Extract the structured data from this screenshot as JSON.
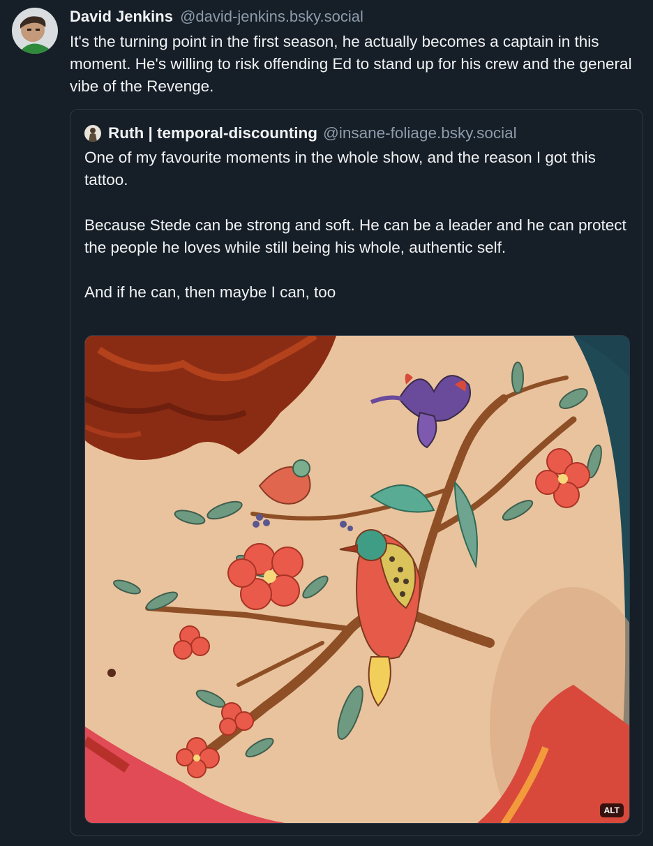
{
  "post": {
    "author_name": "David Jenkins",
    "author_handle": "@david-jenkins.bsky.social",
    "text": "It's the turning point in the first season, he actually becomes a captain in this moment. He's willing to risk offending Ed to stand up for his crew and the general vibe of the Revenge.",
    "avatar_icon": "avatar-photo-icon"
  },
  "quote": {
    "author_name": "Ruth | temporal-discounting",
    "author_handle": "@insane-foliage.bsky.social",
    "paragraphs": [
      "One of my favourite moments in the whole show, and the reason I got this tattoo.",
      "Because Stede can be strong and soft. He can be a leader and he can protect the people he loves while still being his whole, authentic self.",
      "And if he can, then maybe I can, too"
    ],
    "avatar_icon": "avatar-photo-icon",
    "image": {
      "alt_badge": "ALT",
      "description_icon": "tattoo-photo"
    }
  },
  "colors": {
    "background": "#161e27",
    "text": "#f1f3f5",
    "muted": "#8d9bab",
    "border": "#2e3a47"
  }
}
